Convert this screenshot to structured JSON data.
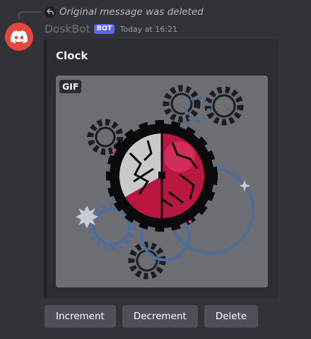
{
  "reply": {
    "text": "Original message was deleted",
    "icon": "reply-arrow-icon"
  },
  "author": {
    "name": "DoskBot",
    "tag": "BOT",
    "timestamp": "Today at 16:21",
    "avatar_icon": "discord-logo-icon",
    "avatar_color": "#e5473e"
  },
  "embed": {
    "title": "Clock",
    "image_badge": "GIF",
    "image_icon": "clock-gears-image"
  },
  "buttons": [
    {
      "label": "Increment"
    },
    {
      "label": "Decrement"
    },
    {
      "label": "Delete"
    }
  ],
  "colors": {
    "background": "#313338",
    "embed_bg": "#2b2d31",
    "bot_tag": "#5865f2",
    "button_bg": "#4e5058"
  }
}
